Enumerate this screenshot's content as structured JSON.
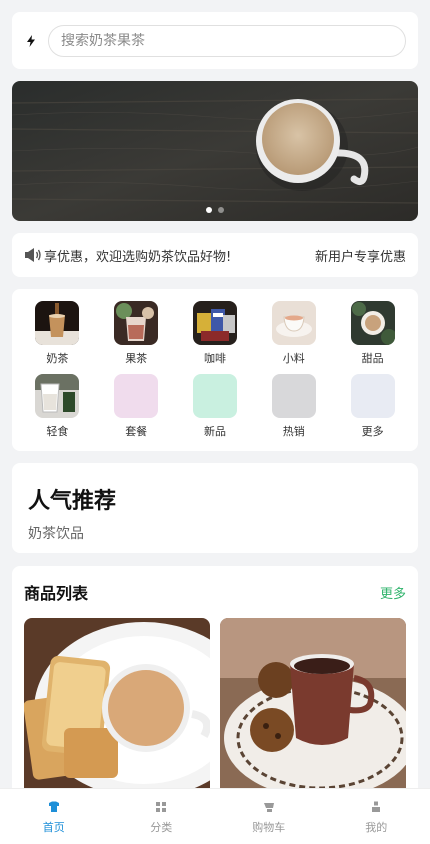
{
  "search": {
    "placeholder": "搜索奶茶果茶"
  },
  "notice": {
    "text": "享优惠，欢迎选购奶茶饮品好物!",
    "right_label": "新用户专享优惠"
  },
  "categories": [
    {
      "label": "奶茶"
    },
    {
      "label": "果茶"
    },
    {
      "label": "咖啡"
    },
    {
      "label": "小料"
    },
    {
      "label": "甜品"
    },
    {
      "label": "轻食"
    },
    {
      "label": "套餐",
      "color": "#f0dced"
    },
    {
      "label": "新品",
      "color": "#c9f0e0"
    },
    {
      "label": "热销",
      "color": "#d8d8da"
    },
    {
      "label": "更多",
      "color": "#e8ebf3"
    }
  ],
  "popular": {
    "title": "人气推荐",
    "subtitle": "奶茶饮品"
  },
  "products": {
    "title": "商品列表",
    "more": "更多"
  },
  "tabbar": {
    "items": [
      {
        "label": "首页",
        "icon": "shirt-icon",
        "active": true
      },
      {
        "label": "分类",
        "icon": "grid-icon"
      },
      {
        "label": "购物车",
        "icon": "cart-icon"
      },
      {
        "label": "我的",
        "icon": "user-icon"
      }
    ]
  },
  "colors": {
    "accent": "#1e8fd8",
    "more_green": "#2fb36b"
  }
}
